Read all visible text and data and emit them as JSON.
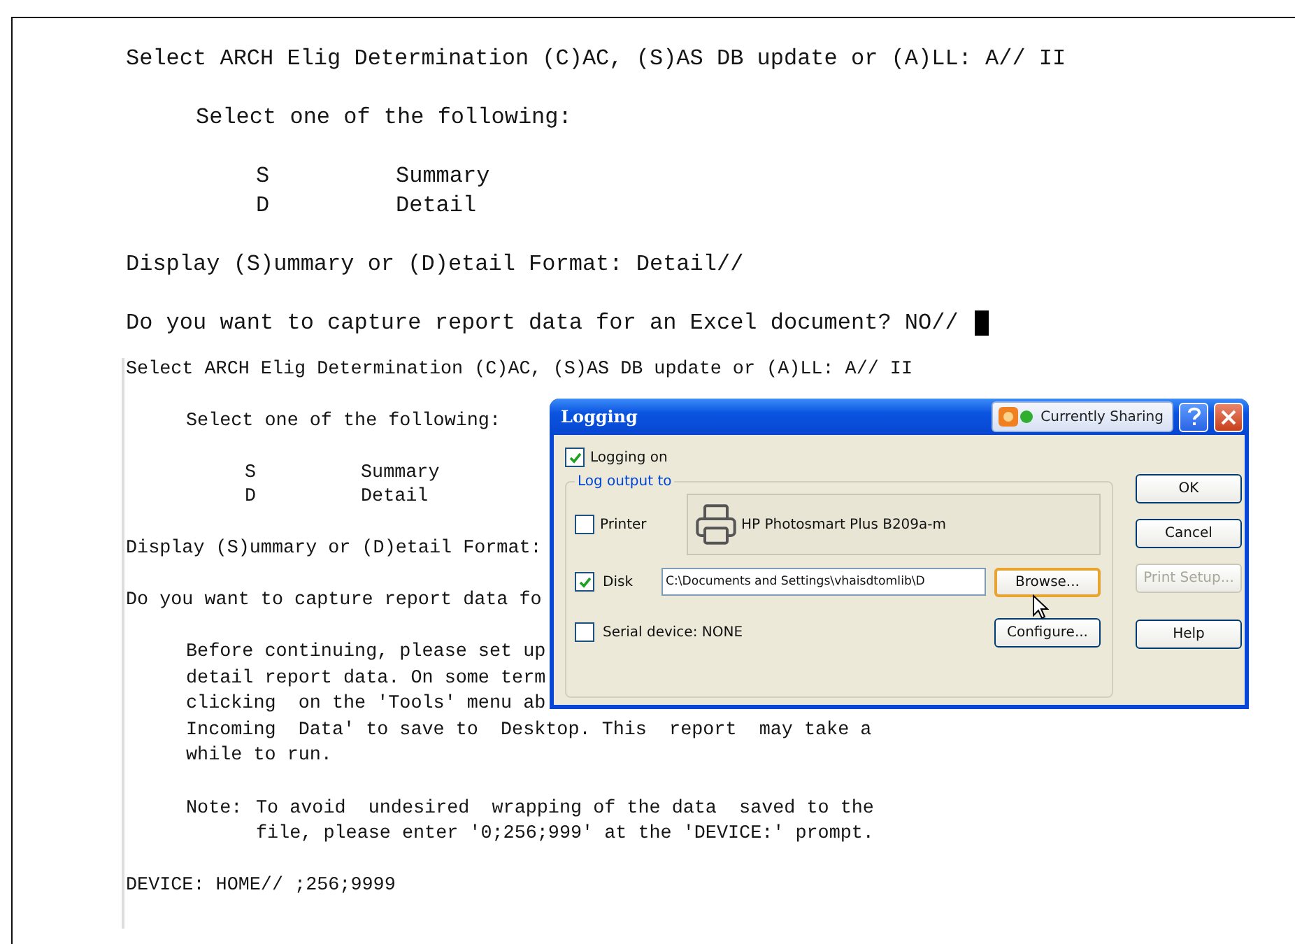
{
  "terminal_top": {
    "lines": [
      {
        "kind": "prompt",
        "text": "Select ARCH Elig Determination (C)AC, (S)AS DB update or (A)LL: A// II"
      },
      {
        "kind": "heading",
        "text": "Select one of the following:"
      },
      {
        "kind": "options",
        "options": [
          {
            "key": "S",
            "label": "Summary"
          },
          {
            "key": "D",
            "label": "Detail"
          }
        ]
      },
      {
        "kind": "prompt",
        "text": "Display (S)ummary or (D)etail Format: Detail//"
      },
      {
        "kind": "prompt",
        "text": "Do you want to capture report data for an Excel document? NO//",
        "cursor": true
      }
    ]
  },
  "terminal_bottom": {
    "lines": [
      {
        "kind": "prompt",
        "text": "Select ARCH Elig Determination (C)AC, (S)AS DB update or (A)LL: A// II"
      },
      {
        "kind": "heading",
        "text": "Select one of the following:"
      },
      {
        "kind": "options",
        "options": [
          {
            "key": "S",
            "label": "Summary"
          },
          {
            "key": "D",
            "label": "Detail"
          }
        ]
      },
      {
        "kind": "prompt",
        "text": "Display (S)ummary or (D)etail Format:"
      },
      {
        "kind": "prompt",
        "text": "Do you want to capture report data fo"
      },
      {
        "kind": "paragraph",
        "lines": [
          "Before continuing, please set up",
          "detail report data. On some term",
          "clicking  on the 'Tools' menu ab",
          "Incoming  Data' to save to  Desktop. This  report  may take a",
          "while to run."
        ]
      },
      {
        "kind": "note",
        "label": "Note:",
        "lines": [
          "To avoid  undesired  wrapping of the data  saved to the",
          "file, please enter '0;256;999' at the 'DEVICE:' prompt."
        ]
      },
      {
        "kind": "prompt",
        "text": "DEVICE: HOME// ;256;9999"
      }
    ]
  },
  "dialog": {
    "title": "Logging",
    "sharing": "Currently Sharing",
    "logging_on": {
      "label": "Logging on",
      "checked": true
    },
    "group_label": "Log output to",
    "printer": {
      "label": "Printer",
      "checked": false,
      "device": "HP Photosmart Plus B209a-m"
    },
    "disk": {
      "label": "Disk",
      "checked": true,
      "path": "C:\\Documents and Settings\\vhaisdtomlib\\D",
      "button": "Browse..."
    },
    "serial": {
      "label": "Serial device:  NONE",
      "checked": false,
      "button": "Configure..."
    },
    "buttons": [
      {
        "label": "OK",
        "disabled": false
      },
      {
        "label": "Cancel",
        "disabled": false
      },
      {
        "label": "Print Setup...",
        "disabled": true
      },
      {
        "label": "Help",
        "disabled": false
      }
    ]
  }
}
